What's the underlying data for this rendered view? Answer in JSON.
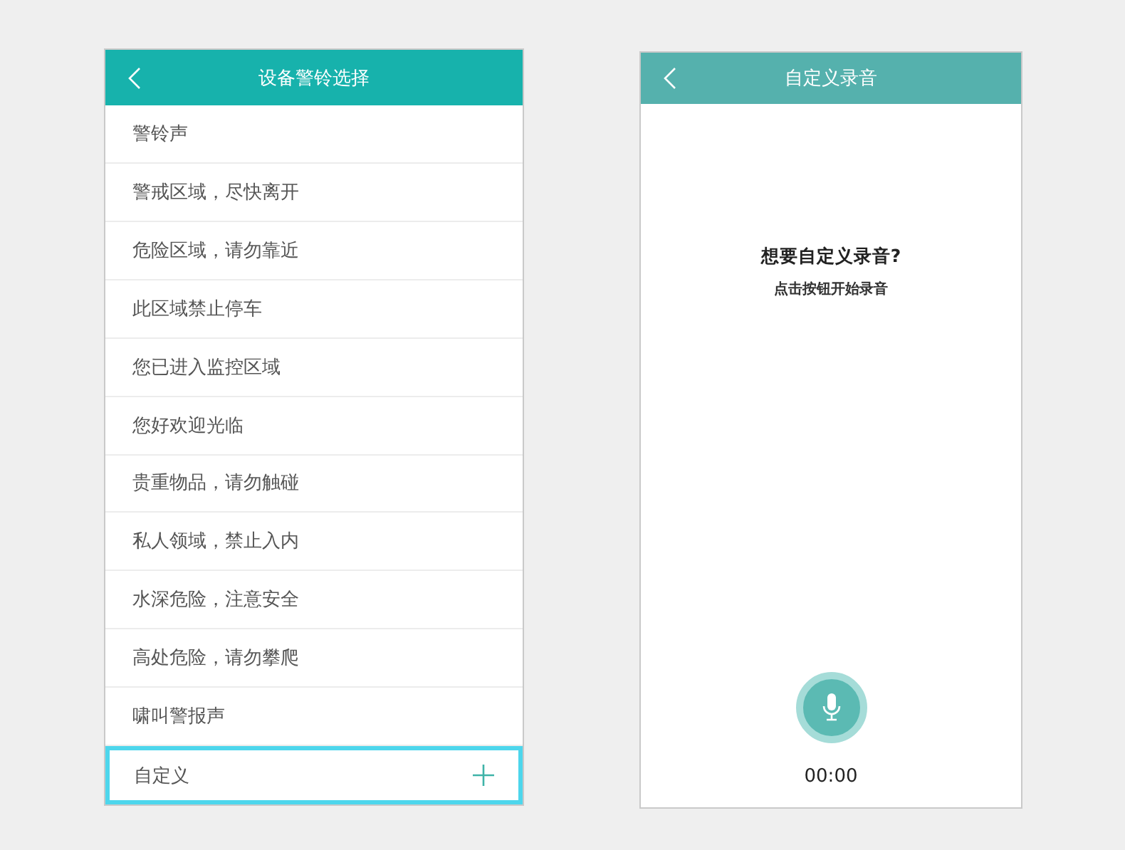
{
  "alarm_screen": {
    "title": "设备警铃选择",
    "items": [
      {
        "label": "警铃声",
        "kind": "plain",
        "selected": false
      },
      {
        "label": "警戒区域，尽快离开",
        "kind": "plain",
        "selected": false
      },
      {
        "label": "危险区域，请勿靠近",
        "kind": "plain",
        "selected": false
      },
      {
        "label": "此区域禁止停车",
        "kind": "plain",
        "selected": false
      },
      {
        "label": "您已进入监控区域",
        "kind": "plain",
        "selected": false
      },
      {
        "label": "您好欢迎光临",
        "kind": "plain",
        "selected": false
      },
      {
        "label": "贵重物品，请勿触碰",
        "kind": "plain",
        "selected": false
      },
      {
        "label": "私人领域，禁止入内",
        "kind": "plain",
        "selected": false
      },
      {
        "label": "水深危险，注意安全",
        "kind": "plain",
        "selected": false
      },
      {
        "label": "高处危险，请勿攀爬",
        "kind": "plain",
        "selected": false
      },
      {
        "label": "啸叫警报声",
        "kind": "plain",
        "selected": false
      },
      {
        "label": "自定义",
        "kind": "add",
        "selected": true
      }
    ]
  },
  "record_screen": {
    "title": "自定义录音",
    "prompt": "想要自定义录音?",
    "hint": "点击按钮开始录音",
    "timer": "00:00"
  }
}
